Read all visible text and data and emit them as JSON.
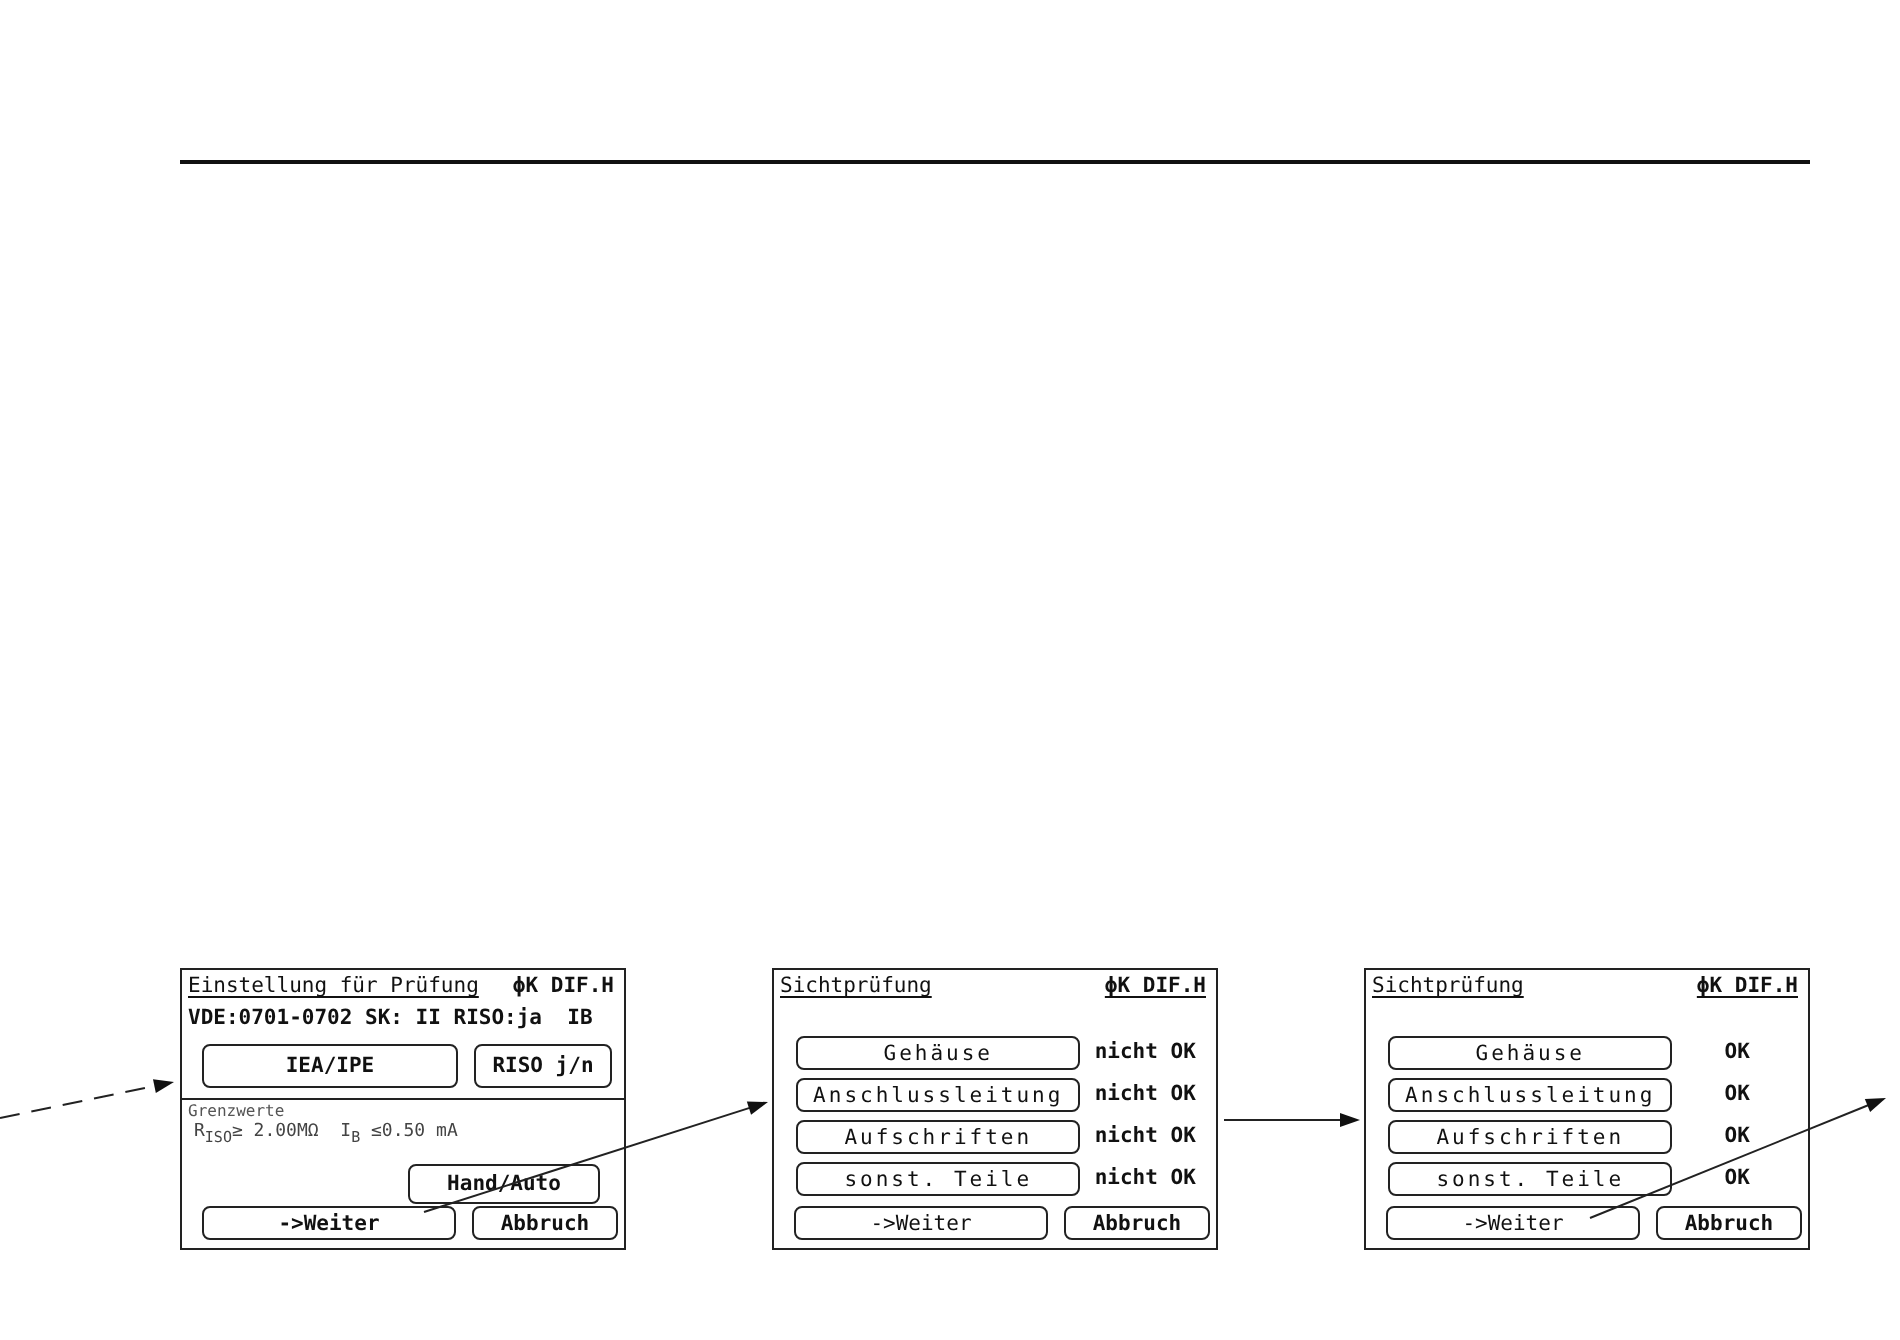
{
  "figure": {
    "screens": [
      {
        "kind": "settings",
        "title": "Einstellung für Prüfung",
        "status": "ϕK DIF.H",
        "info": "VDE:0701-0702 SK: II RISO:ja  IB",
        "top_buttons": [
          "IEA/IPE",
          "RISO j/n"
        ],
        "section": "Grenzwerte",
        "limits": "R$_{ISO}$≥ 2.00MΩ  I$_{B}$ ≤0.50 mA",
        "mode_button": "Hand/Auto",
        "footer_buttons": [
          "->Weiter",
          "Abbruch"
        ]
      },
      {
        "kind": "checklist",
        "title": "Sichtprüfung",
        "status": "ϕK DIF.H",
        "items": [
          {
            "label": "Gehäuse",
            "result": "nicht OK"
          },
          {
            "label": "Anschlussleitung",
            "result": "nicht OK"
          },
          {
            "label": "Aufschriften",
            "result": "nicht OK"
          },
          {
            "label": "sonst. Teile",
            "result": "nicht OK"
          }
        ],
        "footer_buttons": [
          "->Weiter",
          "Abbruch"
        ]
      },
      {
        "kind": "checklist",
        "title": "Sichtprüfung",
        "status": "ϕK DIF.H",
        "items": [
          {
            "label": "Gehäuse",
            "result": "OK"
          },
          {
            "label": "Anschlussleitung",
            "result": "OK"
          },
          {
            "label": "Aufschriften",
            "result": "OK"
          },
          {
            "label": "sonst. Teile",
            "result": "OK"
          }
        ],
        "footer_buttons": [
          "->Weiter",
          "Abbruch"
        ]
      }
    ]
  }
}
